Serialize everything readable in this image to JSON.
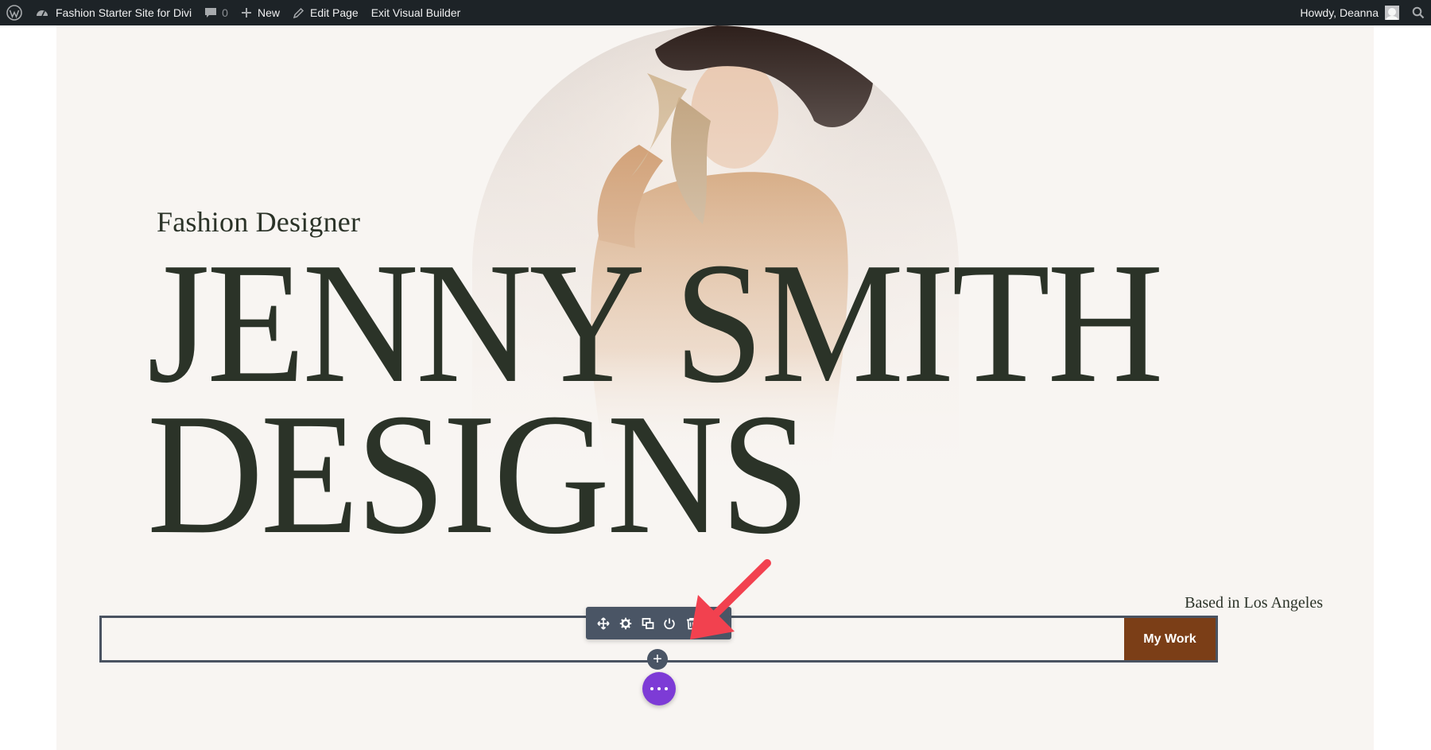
{
  "adminbar": {
    "site_title": "Fashion Starter Site for Divi",
    "comments_count": "0",
    "new_label": "New",
    "edit_page_label": "Edit Page",
    "exit_builder_label": "Exit Visual Builder",
    "greeting": "Howdy, Deanna"
  },
  "hero": {
    "eyebrow": "Fashion Designer",
    "headline_line1": "JENNY SMITH",
    "headline_line2": "DESIGNS",
    "location": "Based in Los Angeles",
    "button_label": "My Work"
  },
  "builder": {
    "toolbar_icons": [
      "move-icon",
      "gear-icon",
      "duplicate-icon",
      "power-icon",
      "trash-icon",
      "more-vertical-icon"
    ],
    "add_symbol": "+"
  },
  "colors": {
    "adminbar_bg": "#1d2327",
    "hero_bg": "#f8f5f2",
    "headline": "#2b3328",
    "button_bg": "#7b3e17",
    "toolbar_bg": "#4a5565",
    "builder_purple": "#7d3bd6",
    "annotation_arrow": "#f2414f"
  }
}
